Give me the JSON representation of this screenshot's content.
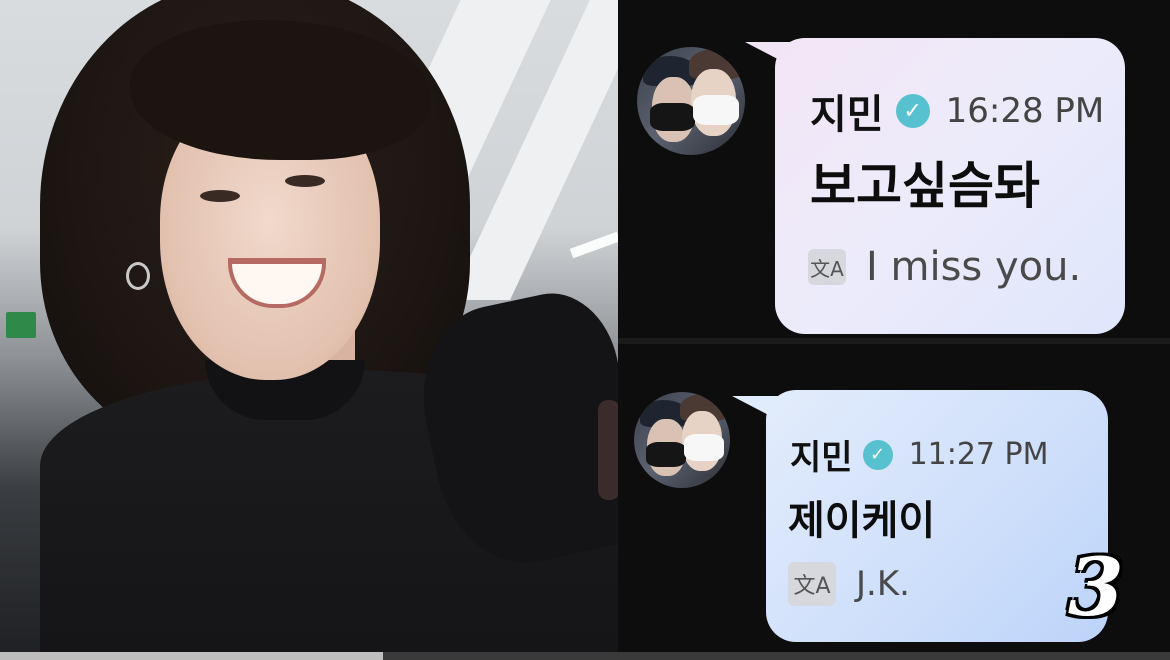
{
  "chat": {
    "first": {
      "sender": "지민",
      "verified_icon": "check-badge-icon",
      "time": "16:28 PM",
      "message": "보고싶슴돠",
      "translate_icon_glyph": "文A",
      "translation": "I miss you."
    },
    "second": {
      "sender": "지민",
      "verified_icon": "check-badge-icon",
      "time": "11:27 PM",
      "message": "제이케이",
      "translate_icon_glyph": "文A",
      "translation": "J.K."
    }
  },
  "overlay_number": "3",
  "colors": {
    "verified": "#58c1d0",
    "bubble_top": "#ecebfb",
    "bubble_bottom": "#d2e1fb",
    "panel_bg": "#0d0d0d"
  }
}
